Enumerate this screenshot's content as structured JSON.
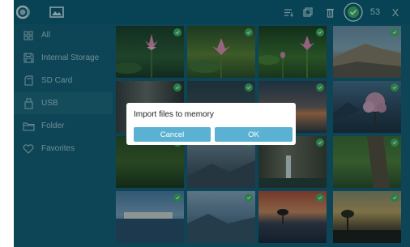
{
  "topbar": {
    "selected_count": "53",
    "icons": [
      "app-logo-icon",
      "gallery-icon",
      "sort-list-icon",
      "copy-icon",
      "delete-icon",
      "select-all-check-icon",
      "close-icon"
    ],
    "close_label": "X"
  },
  "sidebar": {
    "items": [
      {
        "label": "All",
        "icon": "grid-icon"
      },
      {
        "label": "Internal Storage",
        "icon": "floppy-icon"
      },
      {
        "label": "SD Card",
        "icon": "sd-card-icon"
      },
      {
        "label": "USB",
        "icon": "usb-icon"
      },
      {
        "label": "Folder",
        "icon": "folder-icon"
      },
      {
        "label": "Favorites",
        "icon": "heart-icon"
      }
    ],
    "selected_index": 3
  },
  "grid": {
    "photos": [
      {
        "subject": "lotus flower",
        "selected": true
      },
      {
        "subject": "lotus flower",
        "selected": true
      },
      {
        "subject": "lotus flower",
        "selected": true
      },
      {
        "subject": "mountain ridge",
        "selected": true
      },
      {
        "subject": "dim corridor",
        "selected": true
      },
      {
        "subject": "dark landscape",
        "selected": true
      },
      {
        "subject": "sunset over water",
        "selected": true
      },
      {
        "subject": "pink blossom tree by lake",
        "selected": true
      },
      {
        "subject": "forest foliage",
        "selected": true
      },
      {
        "subject": "misty mountains",
        "selected": true
      },
      {
        "subject": "waterfall cliff",
        "selected": true
      },
      {
        "subject": "tree trunk",
        "selected": true
      },
      {
        "subject": "river town",
        "selected": true
      },
      {
        "subject": "cloudy hills",
        "selected": true
      },
      {
        "subject": "lakeside sunset tree",
        "selected": true
      },
      {
        "subject": "dusk silhouette",
        "selected": true
      }
    ]
  },
  "dialog": {
    "title": "Import files to memory",
    "cancel_label": "Cancel",
    "ok_label": "OK"
  },
  "colors": {
    "background": "#145c73",
    "topbar": "#0b5a6f",
    "dialog_button": "#5bb1d1",
    "check_badge": "#3fb45b"
  }
}
